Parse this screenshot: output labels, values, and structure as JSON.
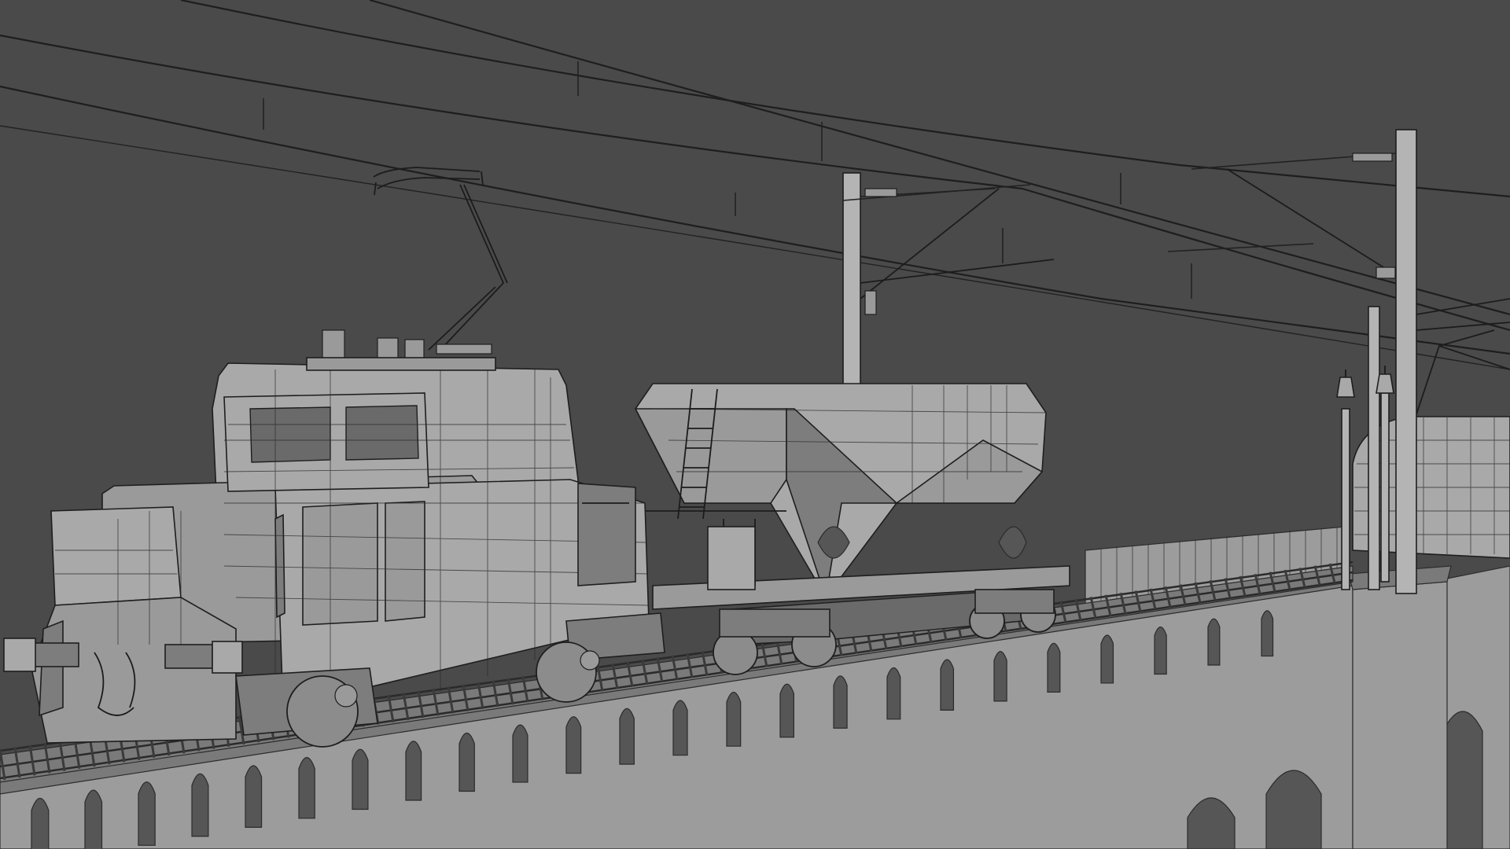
{
  "scene": {
    "background_color": "#4a4a4a",
    "model_color": "#a9a9a9",
    "wireframe_color": "#1e1e1e",
    "objects": [
      "overhead-catenary-wires",
      "catenary-masts",
      "electric-locomotive",
      "pantograph",
      "hopper-wagon",
      "stone-arched-viaduct",
      "railway-track",
      "street-lamps",
      "distant-train"
    ]
  }
}
